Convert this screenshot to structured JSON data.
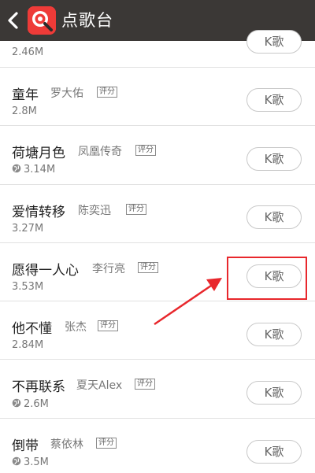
{
  "header": {
    "title": "点歌台",
    "back_icon": "back-arrow-icon",
    "app_icon": "singing-app-icon",
    "bg_color": "#3b3836"
  },
  "songs": [
    {
      "title": "",
      "artist": "",
      "badge": "",
      "size": "2.46M",
      "online": false,
      "button": "K歌"
    },
    {
      "title": "童年",
      "artist": "罗大佑",
      "badge": "评分",
      "size": "2.8M",
      "online": false,
      "button": "K歌"
    },
    {
      "title": "荷塘月色",
      "artist": "凤凰传奇",
      "badge": "评分",
      "size": "3.14M",
      "online": true,
      "button": "K歌"
    },
    {
      "title": "爱情转移",
      "artist": "陈奕迅",
      "badge": "评分",
      "size": "3.27M",
      "online": false,
      "button": "K歌"
    },
    {
      "title": "愿得一人心",
      "artist": "李行亮",
      "badge": "评分",
      "size": "3.53M",
      "online": false,
      "button": "K歌"
    },
    {
      "title": "他不懂",
      "artist": "张杰",
      "badge": "评分",
      "size": "2.84M",
      "online": false,
      "button": "K歌"
    },
    {
      "title": "不再联系",
      "artist": "夏天Alex",
      "badge": "评分",
      "size": "2.6M",
      "online": true,
      "button": "K歌"
    },
    {
      "title": "倒带",
      "artist": "蔡依林",
      "badge": "评分",
      "size": "3.5M",
      "online": true,
      "button": "K歌"
    }
  ],
  "annotation": {
    "color": "#e8272c",
    "target": "愿得一人心 K歌 button"
  }
}
